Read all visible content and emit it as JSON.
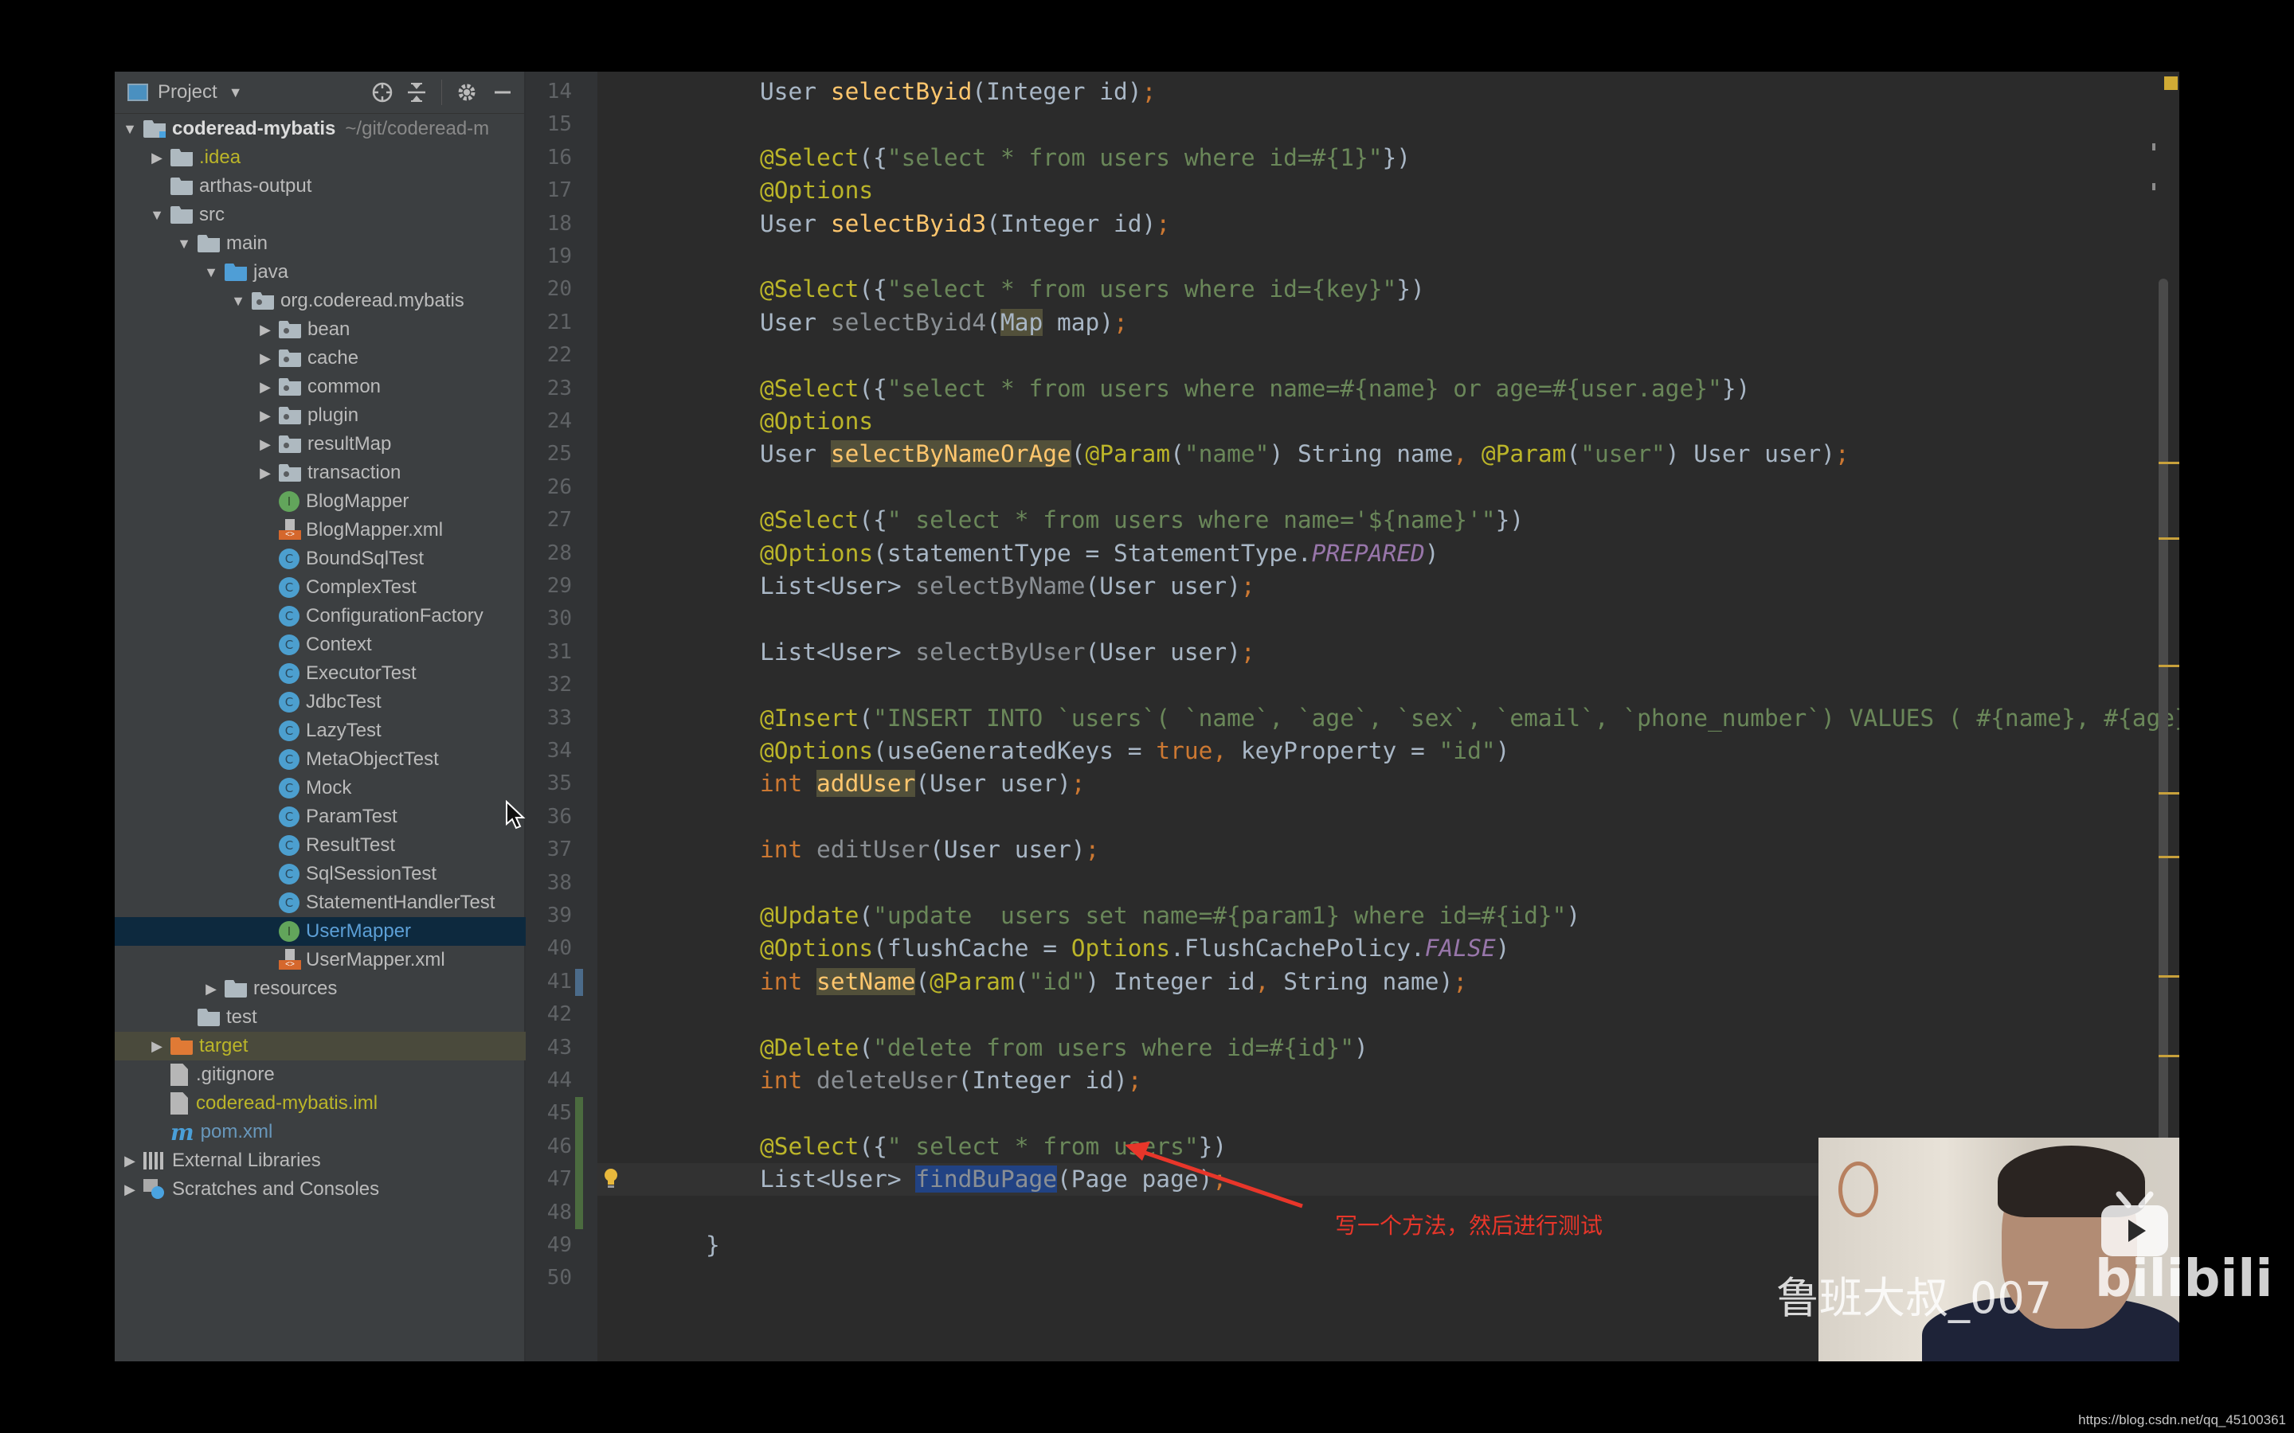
{
  "sidebar": {
    "header": {
      "title": "Project",
      "icons": [
        "locate-icon",
        "collapse-all-icon",
        "gear-icon",
        "minimize-icon"
      ]
    },
    "tree": [
      {
        "label": "coderead-mybatis",
        "suffix": "~/git/coderead-m",
        "depth": 0,
        "arrow": "▼",
        "icon": "module-folder",
        "style": "bold"
      },
      {
        "label": ".idea",
        "depth": 1,
        "arrow": "▶",
        "icon": "folder",
        "style": "yellow"
      },
      {
        "label": "arthas-output",
        "depth": 1,
        "arrow": "",
        "icon": "folder"
      },
      {
        "label": "src",
        "depth": 1,
        "arrow": "▼",
        "icon": "folder"
      },
      {
        "label": "main",
        "depth": 2,
        "arrow": "▼",
        "icon": "folder"
      },
      {
        "label": "java",
        "depth": 3,
        "arrow": "▼",
        "icon": "folder-blue"
      },
      {
        "label": "org.coderead.mybatis",
        "depth": 4,
        "arrow": "▼",
        "icon": "package"
      },
      {
        "label": "bean",
        "depth": 5,
        "arrow": "▶",
        "icon": "package"
      },
      {
        "label": "cache",
        "depth": 5,
        "arrow": "▶",
        "icon": "package"
      },
      {
        "label": "common",
        "depth": 5,
        "arrow": "▶",
        "icon": "package"
      },
      {
        "label": "plugin",
        "depth": 5,
        "arrow": "▶",
        "icon": "package"
      },
      {
        "label": "resultMap",
        "depth": 5,
        "arrow": "▶",
        "icon": "package"
      },
      {
        "label": "transaction",
        "depth": 5,
        "arrow": "▶",
        "icon": "package"
      },
      {
        "label": "BlogMapper",
        "depth": 5,
        "arrow": "",
        "icon": "interface"
      },
      {
        "label": "BlogMapper.xml",
        "depth": 5,
        "arrow": "",
        "icon": "xml"
      },
      {
        "label": "BoundSqlTest",
        "depth": 5,
        "arrow": "",
        "icon": "class"
      },
      {
        "label": "ComplexTest",
        "depth": 5,
        "arrow": "",
        "icon": "class"
      },
      {
        "label": "ConfigurationFactory",
        "depth": 5,
        "arrow": "",
        "icon": "class"
      },
      {
        "label": "Context",
        "depth": 5,
        "arrow": "",
        "icon": "class"
      },
      {
        "label": "ExecutorTest",
        "depth": 5,
        "arrow": "",
        "icon": "class"
      },
      {
        "label": "JdbcTest",
        "depth": 5,
        "arrow": "",
        "icon": "class"
      },
      {
        "label": "LazyTest",
        "depth": 5,
        "arrow": "",
        "icon": "class"
      },
      {
        "label": "MetaObjectTest",
        "depth": 5,
        "arrow": "",
        "icon": "class"
      },
      {
        "label": "Mock",
        "depth": 5,
        "arrow": "",
        "icon": "class"
      },
      {
        "label": "ParamTest",
        "depth": 5,
        "arrow": "",
        "icon": "class"
      },
      {
        "label": "ResultTest",
        "depth": 5,
        "arrow": "",
        "icon": "class"
      },
      {
        "label": "SqlSessionTest",
        "depth": 5,
        "arrow": "",
        "icon": "class"
      },
      {
        "label": "StatementHandlerTest",
        "depth": 5,
        "arrow": "",
        "icon": "class"
      },
      {
        "label": "UserMapper",
        "depth": 5,
        "arrow": "",
        "icon": "interface",
        "selected": true
      },
      {
        "label": "UserMapper.xml",
        "depth": 5,
        "arrow": "",
        "icon": "xml"
      },
      {
        "label": "resources",
        "depth": 3,
        "arrow": "▶",
        "icon": "folder"
      },
      {
        "label": "test",
        "depth": 2,
        "arrow": "",
        "icon": "folder"
      },
      {
        "label": "target",
        "depth": 1,
        "arrow": "▶",
        "icon": "folder-orange",
        "style": "yellow",
        "excluded": true
      },
      {
        "label": ".gitignore",
        "depth": 1,
        "arrow": "",
        "icon": "file"
      },
      {
        "label": "coderead-mybatis.iml",
        "depth": 1,
        "arrow": "",
        "icon": "file",
        "style": "yellow"
      },
      {
        "label": "pom.xml",
        "depth": 1,
        "arrow": "",
        "icon": "maven",
        "style": "blue"
      },
      {
        "label": "External Libraries",
        "depth": 0,
        "arrow": "▶",
        "icon": "libraries"
      },
      {
        "label": "Scratches and Consoles",
        "depth": 0,
        "arrow": "▶",
        "icon": "scratches"
      }
    ]
  },
  "editor": {
    "first_line": 14,
    "caret_line": 47,
    "lines": [
      {
        "n": 14,
        "tokens": [
          [
            "plain",
            "User "
          ],
          [
            "mth",
            "selectByid"
          ],
          [
            "plain",
            "(Integer id)"
          ],
          [
            "kw",
            ";"
          ]
        ]
      },
      {
        "n": 15,
        "tokens": []
      },
      {
        "n": 16,
        "tokens": [
          [
            "ann",
            "@Select"
          ],
          [
            "plain",
            "({"
          ],
          [
            "str",
            "\"select * from users where id=#{1}\""
          ],
          [
            "plain",
            "})"
          ]
        ]
      },
      {
        "n": 17,
        "tokens": [
          [
            "ann",
            "@Options"
          ]
        ]
      },
      {
        "n": 18,
        "tokens": [
          [
            "plain",
            "User "
          ],
          [
            "mth",
            "selectByid3"
          ],
          [
            "plain",
            "(Integer id)"
          ],
          [
            "kw",
            ";"
          ]
        ]
      },
      {
        "n": 19,
        "tokens": []
      },
      {
        "n": 20,
        "tokens": [
          [
            "ann",
            "@Select"
          ],
          [
            "plain",
            "({"
          ],
          [
            "str",
            "\"select * from users where id={key}\""
          ],
          [
            "plain",
            "})"
          ]
        ]
      },
      {
        "n": 21,
        "tokens": [
          [
            "plain",
            "User "
          ],
          [
            "dim",
            "selectByid4"
          ],
          [
            "plain",
            "("
          ],
          [
            "hlplain",
            "Map"
          ],
          [
            "plain",
            " map)"
          ],
          [
            "kw",
            ";"
          ]
        ]
      },
      {
        "n": 22,
        "tokens": []
      },
      {
        "n": 23,
        "tokens": [
          [
            "ann",
            "@Select"
          ],
          [
            "plain",
            "({"
          ],
          [
            "str",
            "\"select * from users where name=#{name} or age=#{user.age}\""
          ],
          [
            "plain",
            "})"
          ]
        ]
      },
      {
        "n": 24,
        "tokens": [
          [
            "ann",
            "@Options"
          ]
        ]
      },
      {
        "n": 25,
        "tokens": [
          [
            "plain",
            "User "
          ],
          [
            "hlmth",
            "selectByNameOrAge"
          ],
          [
            "plain",
            "("
          ],
          [
            "ann",
            "@Param"
          ],
          [
            "plain",
            "("
          ],
          [
            "str",
            "\"name\""
          ],
          [
            "plain",
            ") String name"
          ],
          [
            "kw",
            ", "
          ],
          [
            "ann",
            "@Param"
          ],
          [
            "plain",
            "("
          ],
          [
            "str",
            "\"user\""
          ],
          [
            "plain",
            ") User user)"
          ],
          [
            "kw",
            ";"
          ]
        ]
      },
      {
        "n": 26,
        "tokens": []
      },
      {
        "n": 27,
        "tokens": [
          [
            "ann",
            "@Select"
          ],
          [
            "plain",
            "({"
          ],
          [
            "str",
            "\" select * from users where name='${name}'\""
          ],
          [
            "plain",
            "})"
          ]
        ]
      },
      {
        "n": 28,
        "tokens": [
          [
            "ann",
            "@Options"
          ],
          [
            "plain",
            "(statementType = StatementType."
          ],
          [
            "const",
            "PREPARED"
          ],
          [
            "plain",
            ")"
          ]
        ]
      },
      {
        "n": 29,
        "tokens": [
          [
            "plain",
            "List<User> "
          ],
          [
            "dim",
            "selectByName"
          ],
          [
            "plain",
            "(User user)"
          ],
          [
            "kw",
            ";"
          ]
        ]
      },
      {
        "n": 30,
        "tokens": []
      },
      {
        "n": 31,
        "tokens": [
          [
            "plain",
            "List<User> "
          ],
          [
            "dim",
            "selectByUser"
          ],
          [
            "plain",
            "(User user)"
          ],
          [
            "kw",
            ";"
          ]
        ]
      },
      {
        "n": 32,
        "tokens": []
      },
      {
        "n": 33,
        "tokens": [
          [
            "ann",
            "@Insert"
          ],
          [
            "plain",
            "("
          ],
          [
            "str",
            "\"INSERT INTO `users`( `name`, `age`, `sex`, `email`, `phone_number`) VALUES ( #{name}, #{age}, #{se"
          ]
        ]
      },
      {
        "n": 34,
        "tokens": [
          [
            "ann",
            "@Options"
          ],
          [
            "plain",
            "(useGeneratedKeys = "
          ],
          [
            "kw",
            "true, "
          ],
          [
            "plain",
            "keyProperty = "
          ],
          [
            "str",
            "\"id\""
          ],
          [
            "plain",
            ")"
          ]
        ]
      },
      {
        "n": 35,
        "tokens": [
          [
            "kw",
            "int "
          ],
          [
            "hlmth",
            "addUser"
          ],
          [
            "plain",
            "(User user)"
          ],
          [
            "kw",
            ";"
          ]
        ]
      },
      {
        "n": 36,
        "tokens": []
      },
      {
        "n": 37,
        "tokens": [
          [
            "kw",
            "int "
          ],
          [
            "dim",
            "editUser"
          ],
          [
            "plain",
            "(User user)"
          ],
          [
            "kw",
            ";"
          ]
        ]
      },
      {
        "n": 38,
        "tokens": []
      },
      {
        "n": 39,
        "tokens": [
          [
            "ann",
            "@Update"
          ],
          [
            "plain",
            "("
          ],
          [
            "str",
            "\"update  users set name=#{param1} where id=#{id}\""
          ],
          [
            "plain",
            ")"
          ]
        ]
      },
      {
        "n": 40,
        "tokens": [
          [
            "ann",
            "@Options"
          ],
          [
            "plain",
            "(flushCache = "
          ],
          [
            "ann",
            "Options"
          ],
          [
            "plain",
            ".FlushCachePolicy."
          ],
          [
            "const",
            "FALSE"
          ],
          [
            "plain",
            ")"
          ]
        ]
      },
      {
        "n": 41,
        "tokens": [
          [
            "kw",
            "int "
          ],
          [
            "hlmth",
            "setName"
          ],
          [
            "plain",
            "("
          ],
          [
            "ann",
            "@Param"
          ],
          [
            "plain",
            "("
          ],
          [
            "str",
            "\"id\""
          ],
          [
            "plain",
            ") Integer id"
          ],
          [
            "kw",
            ", "
          ],
          [
            "plain",
            "String name)"
          ],
          [
            "kw",
            ";"
          ]
        ]
      },
      {
        "n": 42,
        "tokens": []
      },
      {
        "n": 43,
        "tokens": [
          [
            "ann",
            "@Delete"
          ],
          [
            "plain",
            "("
          ],
          [
            "str",
            "\"delete from users where id=#{id}\""
          ],
          [
            "plain",
            ")"
          ]
        ]
      },
      {
        "n": 44,
        "tokens": [
          [
            "kw",
            "int "
          ],
          [
            "dim",
            "deleteUser"
          ],
          [
            "plain",
            "(Integer id)"
          ],
          [
            "kw",
            ";"
          ]
        ]
      },
      {
        "n": 45,
        "tokens": []
      },
      {
        "n": 46,
        "tokens": [
          [
            "ann",
            "@Select"
          ],
          [
            "plain",
            "({"
          ],
          [
            "str",
            "\" select * from users\""
          ],
          [
            "plain",
            "})"
          ]
        ]
      },
      {
        "n": 47,
        "tokens": [
          [
            "plain",
            "List<User> "
          ],
          [
            "sel",
            "findBuPage"
          ],
          [
            "plain",
            "(Page page)"
          ],
          [
            "kw",
            ";"
          ]
        ]
      },
      {
        "n": 48,
        "tokens": []
      },
      {
        "n": 49,
        "tokens": [
          [
            "plain",
            "}"
          ]
        ],
        "indent": 0
      },
      {
        "n": 50,
        "tokens": []
      }
    ]
  },
  "annotation": {
    "text": "写一个方法，然后进行测试",
    "color": "#e8362a"
  },
  "overlay": {
    "watermark": "鲁班大叔_007",
    "platform_logo": "bilibili",
    "platform_text": "bilibili",
    "source_url": "https://blog.csdn.net/qq_45100361"
  },
  "colors": {
    "annotation": "#bbb529",
    "string": "#6a8759",
    "keyword": "#cc7832",
    "method": "#ffc66d",
    "constant": "#9876aa",
    "selection": "#214283",
    "selected_tree_row": "#0d293e"
  }
}
